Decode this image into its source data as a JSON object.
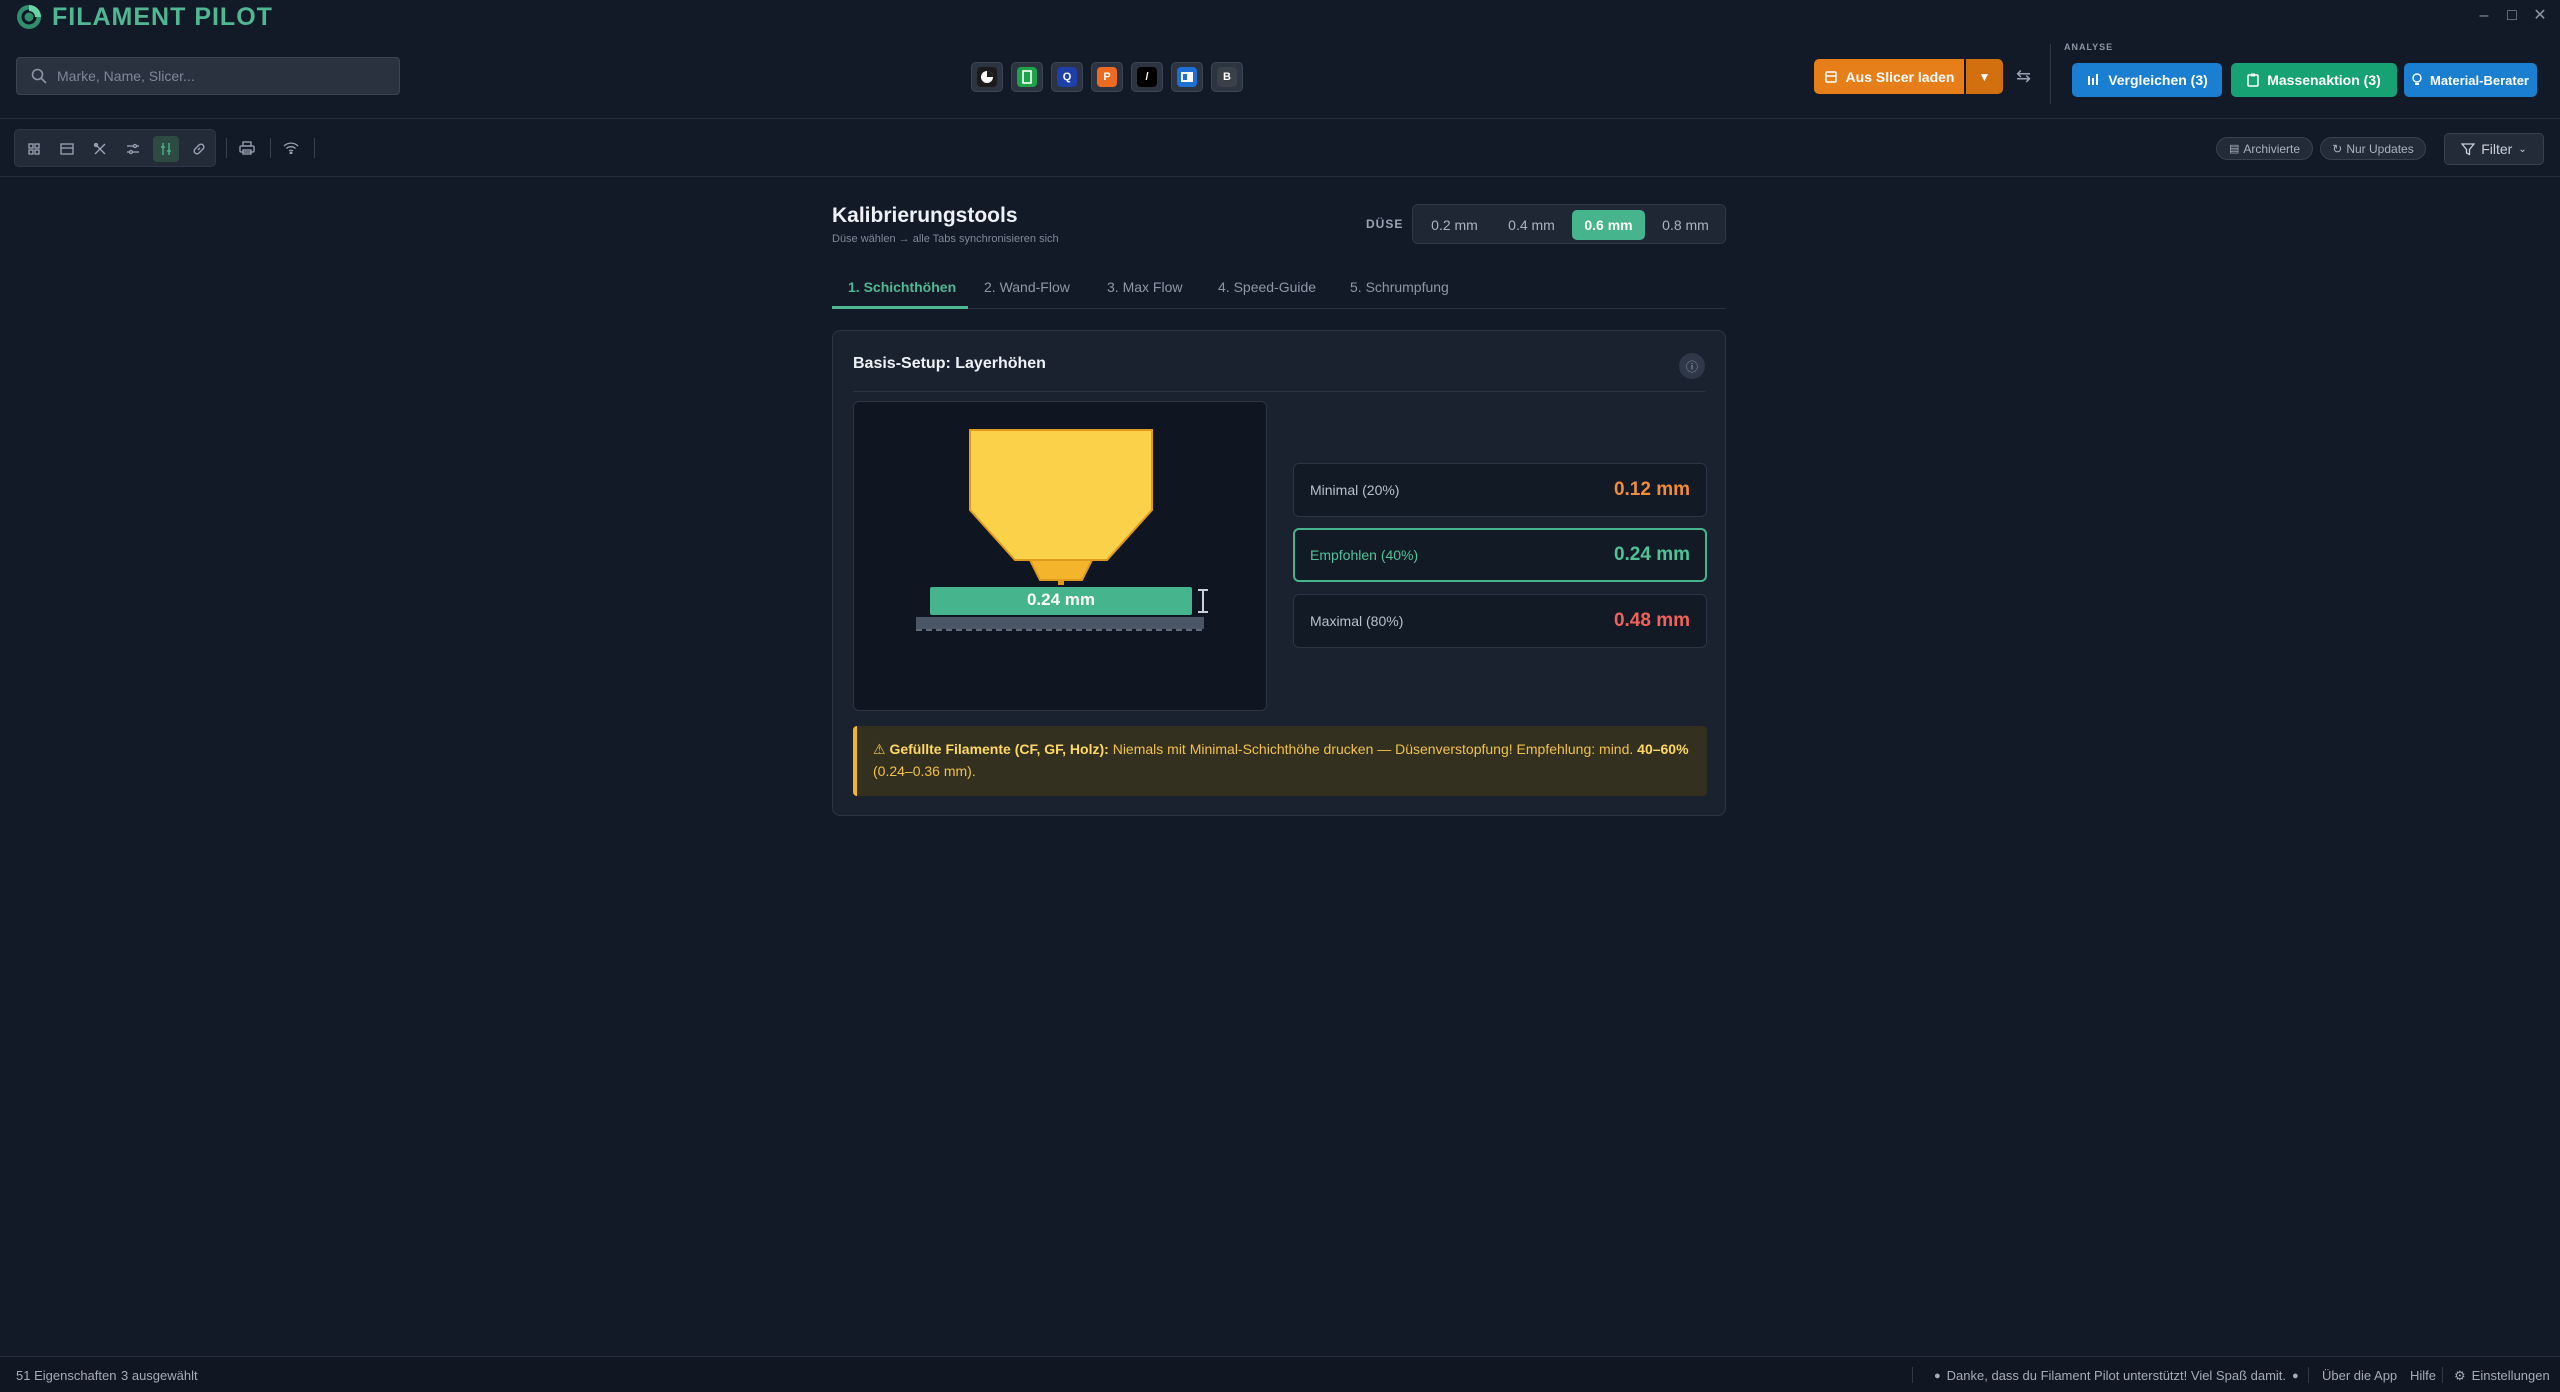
{
  "app": {
    "title": "FILAMENT PILOT"
  },
  "header": {
    "search_placeholder": "Marke, Name, Slicer...",
    "slicers": [
      {
        "icon": "slicer-bambu-icon",
        "letter": "",
        "color": "#1b1b1b"
      },
      {
        "icon": "slicer-green-icon",
        "letter": "",
        "color": "#1fa34a"
      },
      {
        "icon": "slicer-q-icon",
        "letter": "Q",
        "color": "#1e3fa8"
      },
      {
        "icon": "slicer-prusa-icon",
        "letter": "P",
        "color": "#ed6b21"
      },
      {
        "icon": "slicer-orca-icon",
        "letter": "/",
        "color": "#000000"
      },
      {
        "icon": "slicer-blue-icon",
        "letter": "",
        "color": "#1d6fd3"
      },
      {
        "icon": "slicer-b-icon",
        "letter": "B",
        "color": "#3a3f48"
      }
    ],
    "load_button": "Aus Slicer laden",
    "analyse_label": "ANALYSE",
    "compare_button": "Vergleichen (3)",
    "bulk_button": "Massenaktion (3)",
    "advisor_button": "Material-Berater"
  },
  "toolbar": {
    "archived": "Archivierte",
    "updates_only": "Nur Updates",
    "filter": "Filter"
  },
  "main": {
    "title": "Kalibrierungstools",
    "subtitle": "Düse wählen → alle Tabs synchronisieren sich",
    "nozzle_label": "DÜSE",
    "nozzles": [
      "0.2 mm",
      "0.4 mm",
      "0.6 mm",
      "0.8 mm"
    ],
    "nozzle_selected": "0.6 mm",
    "tabs": [
      "1. Schichthöhen",
      "2. Wand-Flow",
      "3. Max Flow",
      "4. Speed-Guide",
      "5. Schrumpfung"
    ],
    "active_tab": "1. Schichthöhen",
    "card": {
      "title": "Basis-Setup: Layerhöhen",
      "diagram_label": "0.24 mm",
      "rows": [
        {
          "label": "Minimal (20%)",
          "value": "0.12 mm",
          "color": "#f28c38"
        },
        {
          "label": "Empfohlen (40%)",
          "value": "0.24 mm",
          "color": "#4fc396"
        },
        {
          "label": "Maximal (80%)",
          "value": "0.48 mm",
          "color": "#f0625a"
        }
      ],
      "warning": {
        "bold_prefix": "Gefüllte Filamente (CF, GF, Holz):",
        "text": " Niemals mit Minimal-Schichthöhe drucken — Düsenverstopfung! Empfehlung: mind. ",
        "bold_range": "40–60%",
        "range_mm": "(0.24–0.36 mm)."
      }
    }
  },
  "statusbar": {
    "properties": "51 Eigenschaften",
    "selected": "3 ausgewählt",
    "thanks": "Danke, dass du Filament Pilot unterstützt! Viel Spaß damit.",
    "about": "Über die App",
    "help": "Hilfe",
    "settings": "Einstellungen"
  },
  "colors": {
    "accent": "#4fb892",
    "orange": "#e67e1a",
    "blue": "#1b7fd1",
    "green": "#17a273"
  }
}
